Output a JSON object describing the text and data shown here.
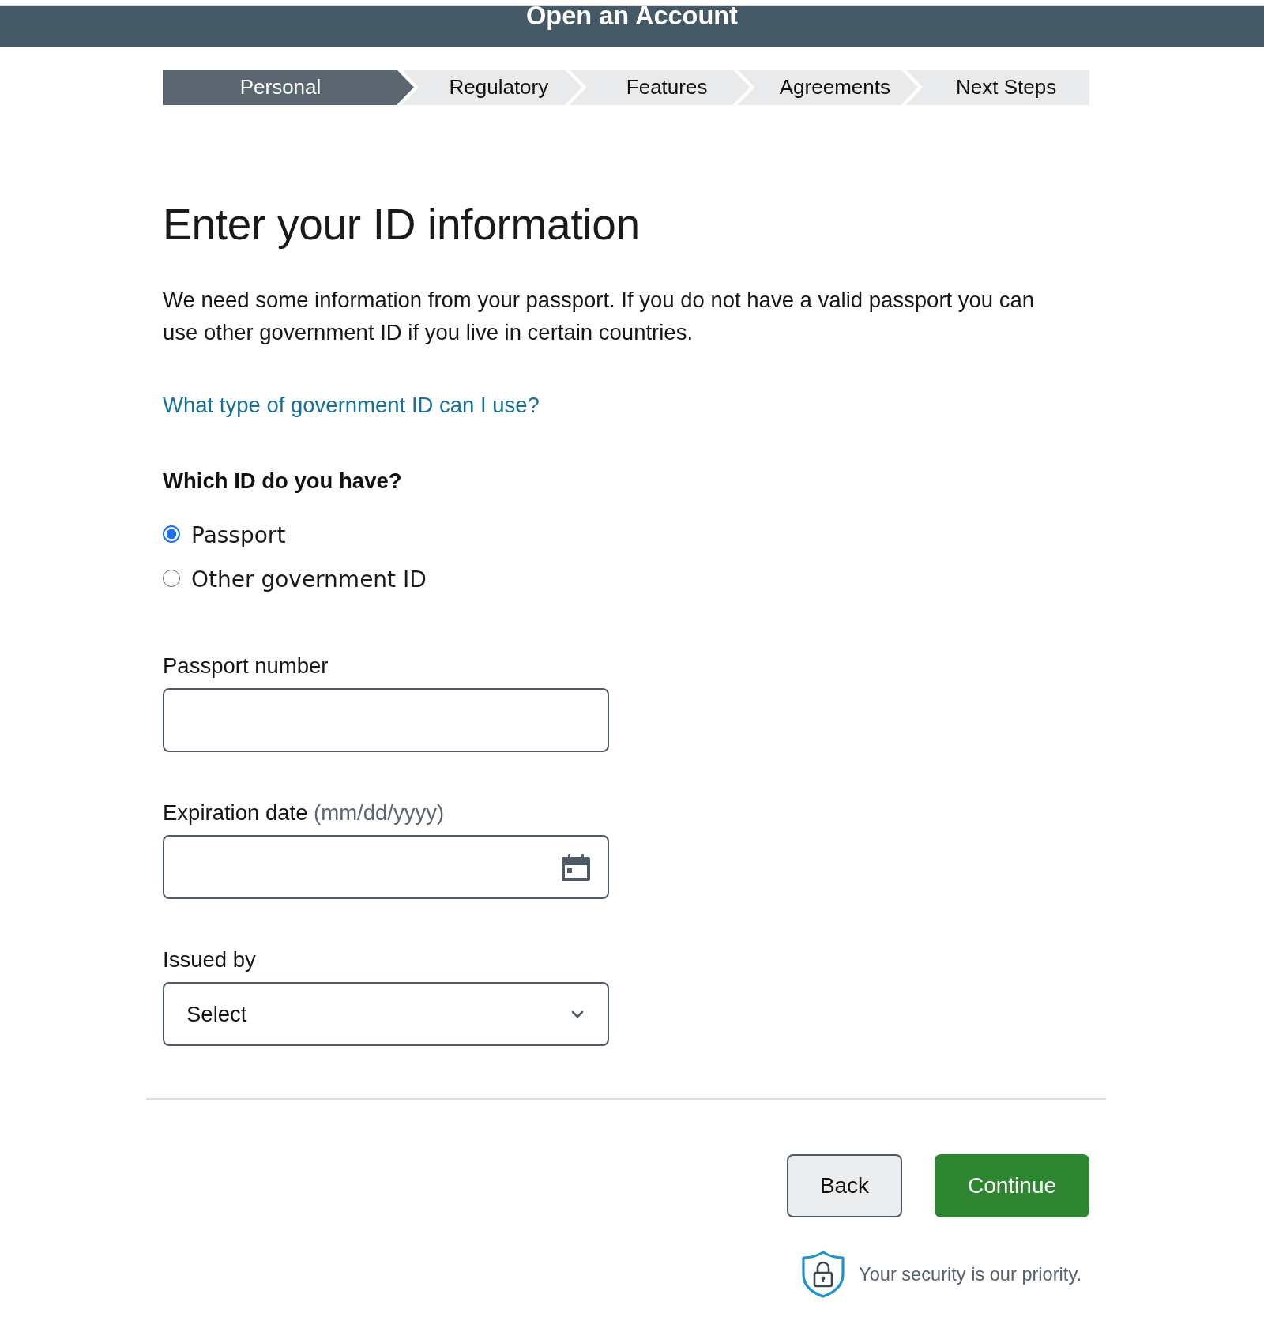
{
  "header": {
    "title": "Open an Account"
  },
  "steps": [
    {
      "label": "Personal",
      "selected": true
    },
    {
      "label": "Regulatory",
      "selected": false
    },
    {
      "label": "Features",
      "selected": false
    },
    {
      "label": "Agreements",
      "selected": false
    },
    {
      "label": "Next Steps",
      "selected": false
    }
  ],
  "heading": "Enter your ID information",
  "intro": "We need some information from your passport. If you do not have a valid passport you can use other government ID if you live in certain countries.",
  "help_link": "What type of government ID can I use?",
  "id_question": {
    "label": "Which ID do you have?",
    "options": [
      {
        "label": "Passport",
        "selected": true
      },
      {
        "label": "Other government ID",
        "selected": false
      }
    ]
  },
  "fields": [
    {
      "kind": "text",
      "label": "Passport number"
    },
    {
      "kind": "date",
      "label": "Expiration date",
      "hint": "(mm/dd/yyyy)"
    },
    {
      "kind": "select",
      "label": "Issued by",
      "value": "Select"
    }
  ],
  "buttons": [
    {
      "kind": "secondary",
      "label": "Back"
    },
    {
      "kind": "primary",
      "label": "Continue"
    }
  ],
  "security_note": "Your security is our priority."
}
